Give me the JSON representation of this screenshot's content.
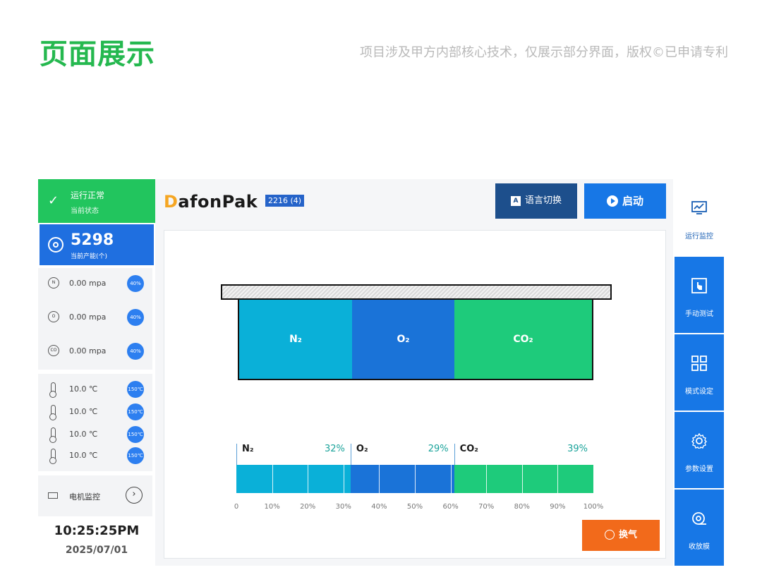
{
  "header": {
    "title": "页面展示",
    "note": "项目涉及甲方内部核心技术，仅展示部分界面，版权©已申请专利"
  },
  "left": {
    "status": {
      "title": "运行正常",
      "subtitle": "当前状态"
    },
    "capacity": {
      "value": "5298",
      "label": "当前产能(个)"
    },
    "gases": [
      {
        "icon": "n2-icon",
        "glyph": "N",
        "value": "0.00  mpa",
        "badge": "40%"
      },
      {
        "icon": "o2-icon",
        "glyph": "O",
        "value": "0.00  mpa",
        "badge": "40%"
      },
      {
        "icon": "co2-icon",
        "glyph": "CO",
        "value": "0.00  mpa",
        "badge": "40%"
      }
    ],
    "temps": [
      {
        "value": "10.0  ℃",
        "badge": "150℃"
      },
      {
        "value": "10.0  ℃",
        "badge": "150℃"
      },
      {
        "value": "10.0  ℃",
        "badge": "150℃"
      },
      {
        "value": "10.0  ℃",
        "badge": "150℃"
      }
    ],
    "motor": {
      "label": "电机监控",
      "arrow": "›"
    },
    "clock": {
      "time": "10:25:25PM",
      "date": "2025/07/01"
    }
  },
  "main": {
    "brand": {
      "d": "D",
      "rest": "afonPak",
      "version": "2216 (4)"
    },
    "lang_button": {
      "icon": "A",
      "label": "语言切换"
    },
    "start_button": {
      "label": "启动"
    },
    "vent_button": {
      "label": "换气"
    }
  },
  "chart_data": {
    "type": "bar",
    "orientation": "horizontal-stacked",
    "series": [
      {
        "name": "N₂",
        "value": 32,
        "color": "#0ab0d8"
      },
      {
        "name": "O₂",
        "value": 29,
        "color": "#1a73d8"
      },
      {
        "name": "CO₂",
        "value": 39,
        "color": "#1ecb7b"
      }
    ],
    "pct_labels": [
      "32%",
      "29%",
      "39%"
    ],
    "tray_labels": [
      "N₂",
      "O₂",
      "CO₂"
    ],
    "axis_ticks": [
      "0",
      "10%",
      "20%",
      "30%",
      "40%",
      "50%",
      "60%",
      "70%",
      "80%",
      "90%",
      "100%"
    ],
    "xlim": [
      0,
      100
    ]
  },
  "nav": [
    {
      "icon": "monitor-icon",
      "label": "运行监控",
      "active": true
    },
    {
      "icon": "hand-test-icon",
      "label": "手动测试",
      "active": false
    },
    {
      "icon": "grid-icon",
      "label": "模式设定",
      "active": false
    },
    {
      "icon": "gear-icon",
      "label": "参数设置",
      "active": false
    },
    {
      "icon": "film-roll-icon",
      "label": "收放膜",
      "active": false
    }
  ]
}
